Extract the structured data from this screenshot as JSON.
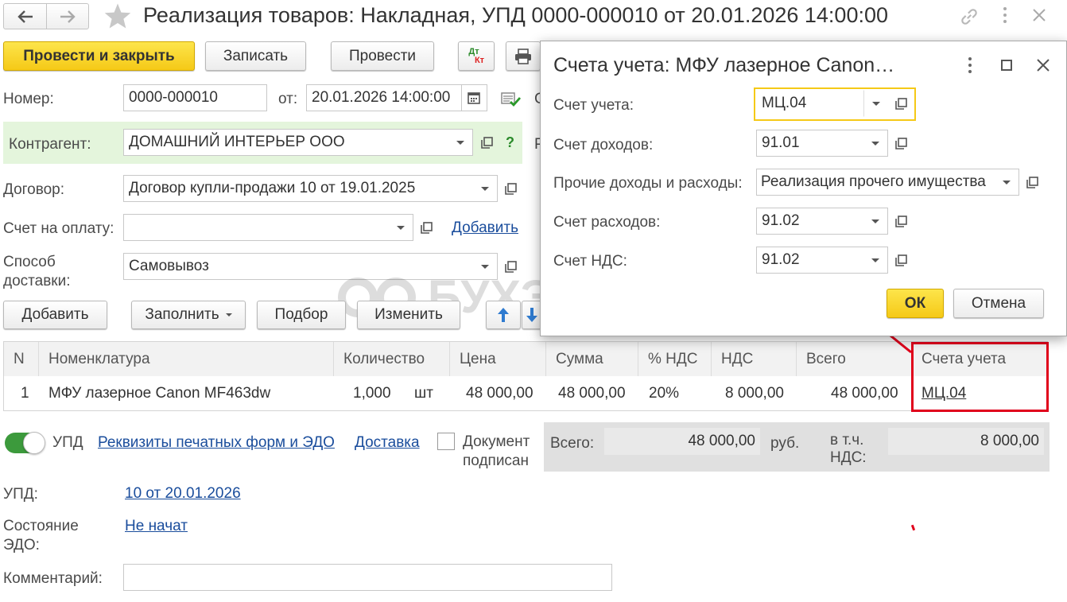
{
  "window": {
    "title": "Реализация товаров: Накладная, УПД 0000-000010 от 20.01.2026 14:00:00"
  },
  "toolbar": {
    "post_close": "Провести и закрыть",
    "save": "Записать",
    "post": "Провести",
    "dtkt_top": "Дт",
    "dtkt_bottom": "Кт"
  },
  "form": {
    "number_label": "Номер:",
    "number_value": "0000-000010",
    "date_label": "от:",
    "date_value": "20.01.2026 14:00:00",
    "counterparty_label": "Контрагент:",
    "counterparty_value": "ДОМАШНИЙ ИНТЕРЬЕР ООО",
    "help": "?",
    "contract_label": "Договор:",
    "contract_value": "Договор купли-продажи 10 от 19.01.2025",
    "invoice_label": "Счет на оплату:",
    "invoice_value": "",
    "invoice_add": "Добавить",
    "delivery_label_1": "Способ",
    "delivery_label_2": "доставки:",
    "delivery_value": "Самовывоз",
    "obscured_letter_1": "С",
    "obscured_letter_2": "Р"
  },
  "table_toolbar": {
    "add": "Добавить",
    "fill": "Заполнить",
    "pick": "Подбор",
    "edit": "Изменить"
  },
  "table": {
    "columns": [
      "N",
      "Номенклатура",
      "Количество",
      "Цена",
      "Сумма",
      "% НДС",
      "НДС",
      "Всего",
      "Счета учета"
    ],
    "rows": [
      {
        "n": "1",
        "item": "МФУ лазерное Canon MF463dw",
        "qty": "1,000",
        "unit": "шт",
        "price": "48 000,00",
        "sum": "48 000,00",
        "vat_rate": "20%",
        "vat": "8 000,00",
        "total": "48 000,00",
        "accounts": "МЦ.04"
      }
    ]
  },
  "footer": {
    "upd_toggle_label": "УПД",
    "print_link": "Реквизиты печатных форм и ЭДО",
    "delivery_link": "Доставка",
    "signed_label_1": "Документ",
    "signed_label_2": "подписан",
    "total_label": "Всего:",
    "total_value": "48 000,00",
    "currency": "руб.",
    "vat_label_1": "в т.ч.",
    "vat_label_2": "НДС:",
    "vat_value": "8 000,00",
    "upd_label": "УПД:",
    "upd_link": "10 от 20.01.2026",
    "edo_label_1": "Состояние",
    "edo_label_2": "ЭДО:",
    "edo_link": "Не начат",
    "comment_label": "Комментарий:",
    "comment_value": ""
  },
  "watermark": "БУХЭКСПЕРТ",
  "dialog": {
    "title": "Счета учета: МФУ лазерное Canon…",
    "account_label": "Счет учета:",
    "account_value": "МЦ.04",
    "income_label": "Счет доходов:",
    "income_value": "91.01",
    "other_label": "Прочие доходы и расходы:",
    "other_value": "Реализация прочего имущества",
    "expense_label": "Счет расходов:",
    "expense_value": "91.02",
    "vat_label": "Счет НДС:",
    "vat_value": "91.02",
    "ok": "ОК",
    "cancel": "Отмена"
  },
  "colors": {
    "primary_button": "#f5c917",
    "highlight_border": "#e0001b",
    "link": "#1a4d9c",
    "counterparty_bg": "#e4f5dc",
    "toggle_on": "#3c9a3c"
  }
}
